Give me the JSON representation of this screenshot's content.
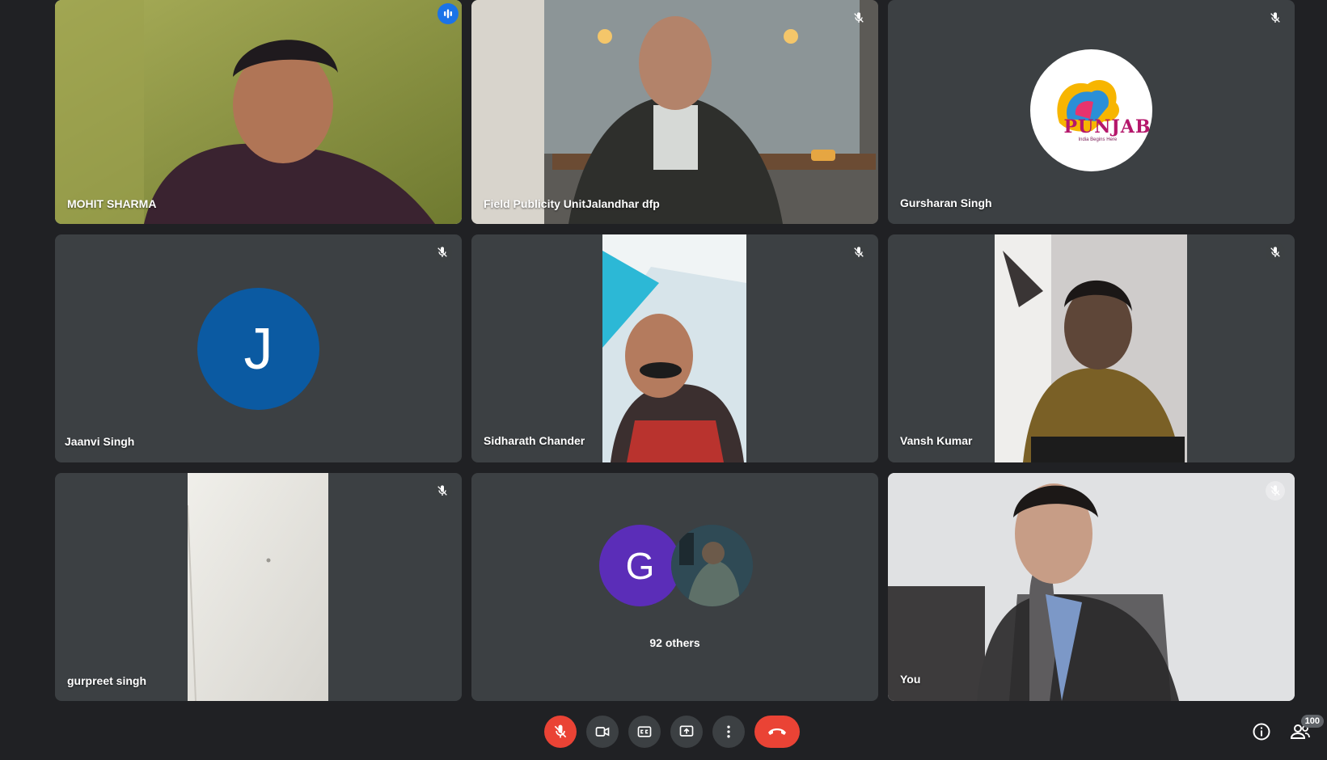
{
  "tiles": {
    "t1": {
      "name": "MOHIT SHARMA"
    },
    "t2": {
      "name": "Field Publicity UnitJalandhar dfp"
    },
    "t3": {
      "name": "Gursharan Singh",
      "logo_text": "PUNJAB",
      "logo_tag": "India Begins Here"
    },
    "t4": {
      "name": "Jaanvi Singh",
      "initial": "J"
    },
    "t5": {
      "name": "Sidharath Chander"
    },
    "t6": {
      "name": "Vansh Kumar"
    },
    "t7": {
      "name": "gurpreet singh"
    },
    "t8": {
      "label": "92 others",
      "initial": "G"
    },
    "t9": {
      "name": "You"
    }
  },
  "controls": {
    "participant_count": "100"
  },
  "colors": {
    "background": "#202124",
    "tile": "#3c4043",
    "speaking_border": "#8ab4f8",
    "avatar_j": "#0b5aa2",
    "avatar_g": "#5b2db8",
    "danger": "#ea4335"
  },
  "icons": [
    "mic-off-icon",
    "audio-level-icon",
    "camera-icon",
    "captions-icon",
    "present-icon",
    "more-icon",
    "end-call-icon",
    "info-icon",
    "people-icon"
  ]
}
